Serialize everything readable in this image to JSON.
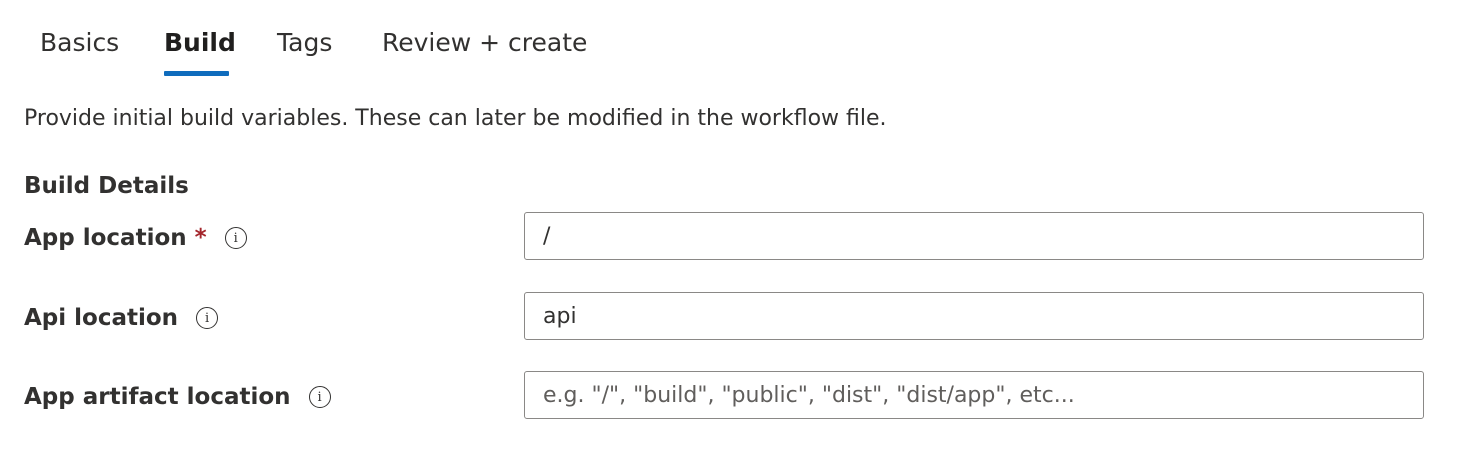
{
  "tabs": [
    {
      "label": "Basics",
      "active": false
    },
    {
      "label": "Build",
      "active": true
    },
    {
      "label": "Tags",
      "active": false
    },
    {
      "label": "Review + create",
      "active": false
    }
  ],
  "description": "Provide initial build variables. These can later be modified in the workflow file.",
  "section_title": "Build Details",
  "fields": {
    "app_location": {
      "label": "App location",
      "required_marker": "*",
      "value": "/",
      "placeholder": ""
    },
    "api_location": {
      "label": "Api location",
      "value": "api",
      "placeholder": ""
    },
    "app_artifact_location": {
      "label": "App artifact location",
      "value": "",
      "placeholder": "e.g. \"/\", \"build\", \"public\", \"dist\", \"dist/app\", etc..."
    }
  },
  "icons": {
    "info": "info-circle-icon"
  },
  "colors": {
    "accent": "#0f6cbd",
    "required": "#a4262c",
    "text": "#323130",
    "border": "#8a8886"
  }
}
